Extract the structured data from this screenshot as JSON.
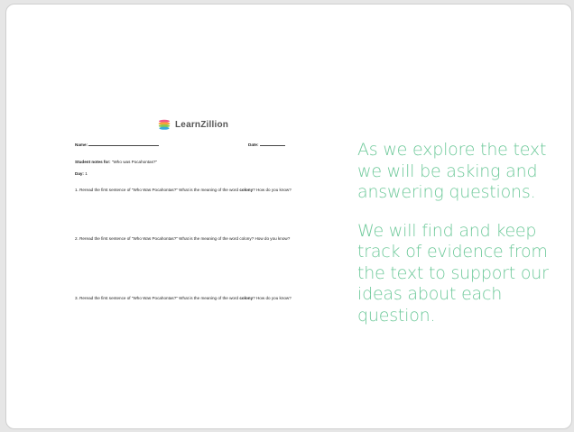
{
  "worksheet": {
    "brand": "LearnZillion",
    "name_label": "Name:",
    "date_label": "Date:",
    "notes_label": "Student notes for:",
    "notes_title": "\"Who was Pocahontas?\"",
    "day_label": "Day:",
    "day_value": "1",
    "questions": [
      {
        "prefix": "1. Reread the first sentence of \"Who Was Pocahontas?\" What is the meaning of the word ",
        "term": "colony",
        "suffix": "? How do you know?"
      },
      {
        "prefix": "2. Reread the first sentence of \"Who Was Pocahontas?\" What is the meaning of the word colony? How do you know?",
        "term": "",
        "suffix": ""
      },
      {
        "prefix": "3. Reread the first sentence of \"Who Was Pocahontas?\" What is the meaning of the word ",
        "term": "colony",
        "suffix": "? How do you know?"
      }
    ]
  },
  "callout": {
    "paragraph1": "As we explore the text we will be asking and answering questions.",
    "paragraph2": "We will find and keep track of evidence from the text to support our ideas about each question."
  },
  "colors": {
    "accent_text": "#6ec99a",
    "logo_stripes": [
      "#f0598a",
      "#f7a23a",
      "#8bc84d",
      "#39a9dc"
    ]
  },
  "icons": {
    "brand": "learnzillion-logo-icon"
  }
}
